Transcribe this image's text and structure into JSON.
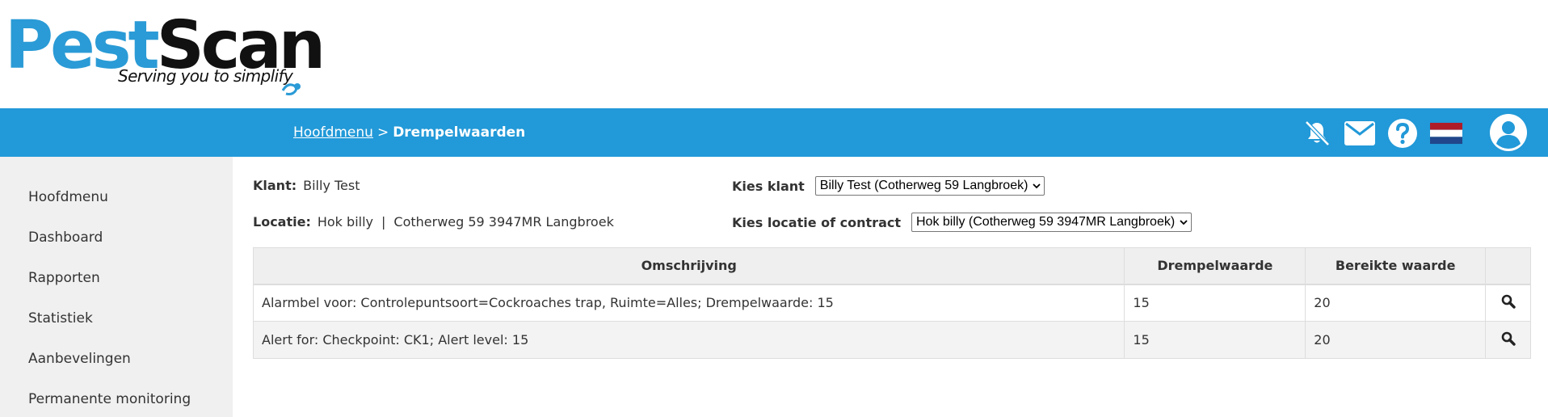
{
  "logo": {
    "brand_part1": "Pest",
    "brand_part2": "Scan",
    "tagline": "Serving you to simplify",
    "colors": {
      "blue": "#2a9bd6",
      "black": "#111111"
    }
  },
  "header": {
    "breadcrumb_home": "Hoofdmenu",
    "breadcrumb_separator": ">",
    "breadcrumb_current": "Drempelwaarden",
    "bar_color": "#2299d8",
    "icons": [
      "notifications-off-icon",
      "mail-icon",
      "help-icon",
      "dutch-flag-icon",
      "user-avatar-icon"
    ]
  },
  "sidebar": {
    "items": [
      {
        "label": "Hoofdmenu"
      },
      {
        "label": "Dashboard"
      },
      {
        "label": "Rapporten"
      },
      {
        "label": "Statistiek"
      },
      {
        "label": "Aanbevelingen"
      },
      {
        "label": "Permanente monitoring"
      }
    ]
  },
  "info": {
    "client_label": "Klant:",
    "client_value": "Billy Test",
    "location_label": "Locatie:",
    "location_name": "Hok billy",
    "location_separator": "|",
    "location_address": "Cotherweg 59 3947MR Langbroek"
  },
  "choosers": {
    "client_label": "Kies klant",
    "client_selected": "Billy Test (Cotherweg 59 Langbroek)",
    "location_label": "Kies locatie of contract",
    "location_selected": "Hok billy (Cotherweg 59 3947MR Langbroek)"
  },
  "table": {
    "columns": [
      "Omschrijving",
      "Drempelwaarde",
      "Bereikte waarde",
      ""
    ],
    "rows": [
      {
        "description": "Alarmbel voor: Controlepuntsoort=Cockroaches trap, Ruimte=Alles; Drempelwaarde: 15",
        "threshold": "15",
        "reached": "20",
        "action_icon": "search-icon"
      },
      {
        "description": "Alert for: Checkpoint: CK1; Alert level: 15",
        "threshold": "15",
        "reached": "20",
        "action_icon": "search-icon"
      }
    ]
  }
}
